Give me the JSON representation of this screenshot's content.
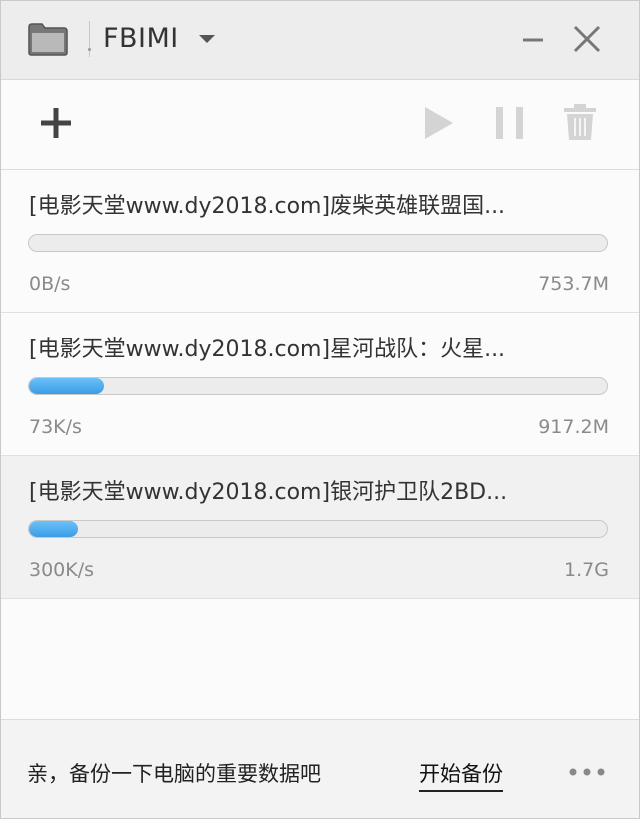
{
  "window": {
    "title": "FBIMI"
  },
  "downloads": [
    {
      "title": "[电影天堂www.dy2018.com]废柴英雄联盟国...",
      "speed": "0B/s",
      "size": "753.7M",
      "progress": 0.0,
      "selected": false
    },
    {
      "title": "[电影天堂www.dy2018.com]星河战队：火星...",
      "speed": "73K/s",
      "size": "917.2M",
      "progress": 0.13,
      "selected": false
    },
    {
      "title": "[电影天堂www.dy2018.com]银河护卫队2BD...",
      "speed": "300K/s",
      "size": "1.7G",
      "progress": 0.085,
      "selected": true
    }
  ],
  "footer": {
    "message": "亲，备份一下电脑的重要数据吧",
    "backup_link": "开始备份"
  },
  "icons": {
    "folder": "folder-icon",
    "dropdown": "chevron-down-icon",
    "minimize": "minimize-icon",
    "close": "close-icon",
    "add": "plus-icon",
    "play": "play-icon",
    "pause": "pause-icon",
    "delete": "trash-icon",
    "more": "more-icon"
  },
  "colors": {
    "progress": "#3a9de6",
    "titlebar": "#ededed"
  }
}
